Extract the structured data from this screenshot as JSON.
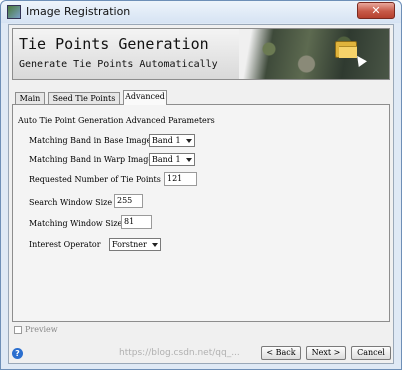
{
  "window": {
    "title": "Image Registration",
    "close_label": "✕"
  },
  "banner": {
    "title": "Tie Points Generation",
    "subtitle": "Generate Tie Points Automatically"
  },
  "tabs": [
    {
      "label": "Main"
    },
    {
      "label": "Seed Tie Points"
    },
    {
      "label": "Advanced"
    }
  ],
  "advanced": {
    "section_title": "Auto Tie Point Generation Advanced Parameters",
    "matching_band_base": {
      "label": "Matching Band in Base Image",
      "value": "Band 1"
    },
    "matching_band_warp": {
      "label": "Matching Band in Warp Image",
      "value": "Band 1"
    },
    "requested_tie_points": {
      "label": "Requested Number of Tie Points",
      "value": "121"
    },
    "search_window": {
      "label": "Search Window Size",
      "value": "255"
    },
    "matching_window": {
      "label": "Matching Window Size",
      "value": "81"
    },
    "interest_operator": {
      "label": "Interest Operator",
      "value": "Forstner"
    }
  },
  "footer": {
    "preview_label": "Preview",
    "help_glyph": "?",
    "back_label": "< Back",
    "next_label": "Next >",
    "cancel_label": "Cancel",
    "watermark": "https://blog.csdn.net/qq_..."
  },
  "colors": {
    "title_bar": "#d6e3f3",
    "close_button": "#c75a48",
    "help_icon": "#2b6fcf"
  }
}
